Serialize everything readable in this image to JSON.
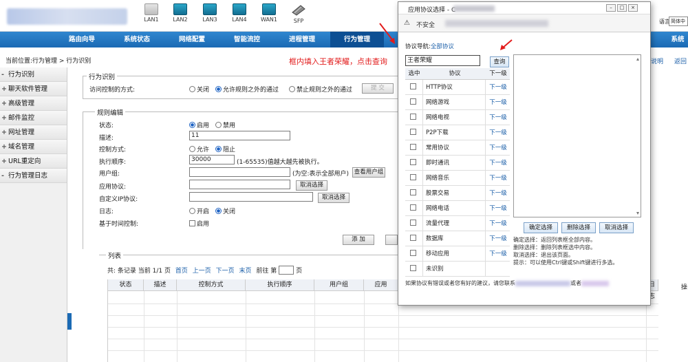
{
  "ports": [
    {
      "label": "LAN1",
      "style": "grey"
    },
    {
      "label": "LAN2",
      "style": "blue"
    },
    {
      "label": "LAN3",
      "style": "blue"
    },
    {
      "label": "LAN4",
      "style": "blue"
    },
    {
      "label": "WAN1",
      "style": "blue"
    },
    {
      "label": "SFP",
      "style": "sfp"
    }
  ],
  "header": {
    "lang_label": "语言:",
    "lang_value": "简体中"
  },
  "nav": [
    "路由向导",
    "系统状态",
    "网络配置",
    "智能流控",
    "进程管理",
    "行为管理",
    "系统"
  ],
  "nav_active": "行为管理",
  "location": "当前位置:行为管理 > 行为识别",
  "hint": "框内填入王者荣耀，点击查询",
  "top_links": {
    "help": "说明",
    "back": "返回"
  },
  "sidebar": [
    {
      "label": "行为识别",
      "sign": "-"
    },
    {
      "label": "聊天软件管理",
      "sign": "+"
    },
    {
      "label": "高级管理",
      "sign": "+"
    },
    {
      "label": "邮件监控",
      "sign": "+"
    },
    {
      "label": "网址管理",
      "sign": "+"
    },
    {
      "label": "域名管理",
      "sign": "+"
    },
    {
      "label": "URL重定向",
      "sign": "+"
    },
    {
      "label": "行为管理日志",
      "sign": "-"
    }
  ],
  "identify": {
    "legend": "行为识别",
    "mode_label": "访问控制的方式:",
    "opt_off": "关闭",
    "opt_allow": "允许规则之外的通过",
    "opt_deny": "禁止规则之外的通过",
    "submit": "提 交"
  },
  "rule": {
    "legend": "规则编辑",
    "status_label": "状态:",
    "status_on": "启用",
    "status_off": "禁用",
    "desc_label": "描述:",
    "desc_value": "11",
    "ctrl_label": "控制方式:",
    "ctrl_allow": "允许",
    "ctrl_block": "阻止",
    "order_label": "执行顺序:",
    "order_value": "30000",
    "order_note": "(1-65535)值越大越先被执行。",
    "group_label": "用户组:",
    "group_note": "(为空:表示全部用户)",
    "group_btn": "查看用户组",
    "proto_label": "应用协议:",
    "cancel_btn": "取消选择",
    "ip_label": "自定义IP协议:",
    "log_label": "日志:",
    "log_on": "开启",
    "log_off": "关闭",
    "time_label": "基于时间控制:",
    "time_on": "启用",
    "add_btn": "添 加"
  },
  "list": {
    "legend": "列表",
    "pager_prefix": "共:",
    "pager_count": "条记录 当前 1/1 页",
    "first": "首页",
    "prev": "上一页",
    "next": "下一页",
    "last": "末页",
    "goto_label": "前往 第",
    "goto_suffix": "页",
    "columns": [
      "状态",
      "描述",
      "控制方式",
      "执行顺序",
      "用户组",
      "应用",
      "日志",
      "操"
    ]
  },
  "popup": {
    "title": "应用协议选择 - C",
    "not_secure": "不安全",
    "nav_label": "协议导航:",
    "nav_link": "全部协议",
    "input_value": "王者荣耀",
    "query_btn": "查询",
    "head": [
      "选中",
      "协议",
      "下一级"
    ],
    "rows": [
      {
        "name": "HTTP协议",
        "next": "下一级"
      },
      {
        "name": "网络游戏",
        "next": "下一级"
      },
      {
        "name": "网络电视",
        "next": "下一级"
      },
      {
        "name": "P2P下载",
        "next": "下一级"
      },
      {
        "name": "常用协议",
        "next": "下一级"
      },
      {
        "name": "即时通讯",
        "next": "下一级"
      },
      {
        "name": "网络音乐",
        "next": "下一级"
      },
      {
        "name": "股票交易",
        "next": "下一级"
      },
      {
        "name": "网络电话",
        "next": "下一级"
      },
      {
        "name": "流量代理",
        "next": "下一级"
      },
      {
        "name": "数据库",
        "next": "下一级"
      },
      {
        "name": "移动应用",
        "next": "下一级"
      },
      {
        "name": "未识别",
        "next": ""
      }
    ],
    "btn_confirm": "确定选择",
    "btn_delete": "删除选择",
    "btn_cancel": "取消选择",
    "notes": [
      "确定选择：返回列表框全部内容。",
      "删除选择：删除列表框选中内容。",
      "取消选择：退出该页面。",
      "提示：可以使用Ctrl键或Shift键进行多选。"
    ],
    "footer": "如果协议有错误或者您有好的建议，请您联系",
    "footer2": "或者"
  },
  "colors": {
    "nav": "#1b6ab4",
    "hint": "#e21b1b",
    "link": "#1a5ea8"
  }
}
